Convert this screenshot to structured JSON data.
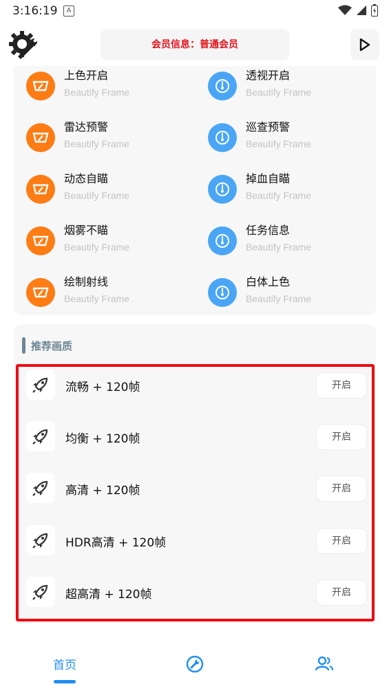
{
  "status_bar": {
    "time": "3:16:19",
    "notification": "A"
  },
  "header": {
    "member_info": "会员信息：普通会员"
  },
  "features": [
    {
      "title": "上色开启",
      "subtitle": "Beautify Frame",
      "icon": "orange-badge-icon"
    },
    {
      "title": "透视开启",
      "subtitle": "Beautify Frame",
      "icon": "blue-gauge-icon"
    },
    {
      "title": "雷达预警",
      "subtitle": "Beautify Frame",
      "icon": "orange-badge-icon"
    },
    {
      "title": "巡查预警",
      "subtitle": "Beautify Frame",
      "icon": "blue-gauge-icon"
    },
    {
      "title": "动态自瞄",
      "subtitle": "Beautify Frame",
      "icon": "orange-badge-icon"
    },
    {
      "title": "掉血自瞄",
      "subtitle": "Beautify Frame",
      "icon": "blue-gauge-icon"
    },
    {
      "title": "烟雾不瞄",
      "subtitle": "Beautify Frame",
      "icon": "orange-badge-icon"
    },
    {
      "title": "任务信息",
      "subtitle": "Beautify Frame",
      "icon": "blue-gauge-icon"
    },
    {
      "title": "绘制射线",
      "subtitle": "Beautify Frame",
      "icon": "orange-badge-icon"
    },
    {
      "title": "白体上色",
      "subtitle": "Beautify Frame",
      "icon": "blue-gauge-icon"
    }
  ],
  "quality": {
    "section_title": "推荐画质",
    "items": [
      {
        "label": "流畅 + 120帧",
        "button": "开启"
      },
      {
        "label": "均衡 + 120帧",
        "button": "开启"
      },
      {
        "label": "高清 + 120帧",
        "button": "开启"
      },
      {
        "label": "HDR高清 + 120帧",
        "button": "开启"
      },
      {
        "label": "超高清 + 120帧",
        "button": "开启"
      }
    ]
  },
  "bottom_nav": {
    "home_label": "首页"
  },
  "colors": {
    "accent": "#1f8ef3",
    "orange": "#fd7c14",
    "blue": "#4aa6f5",
    "highlight": "#ee0b14",
    "member_text": "#e0141c"
  }
}
